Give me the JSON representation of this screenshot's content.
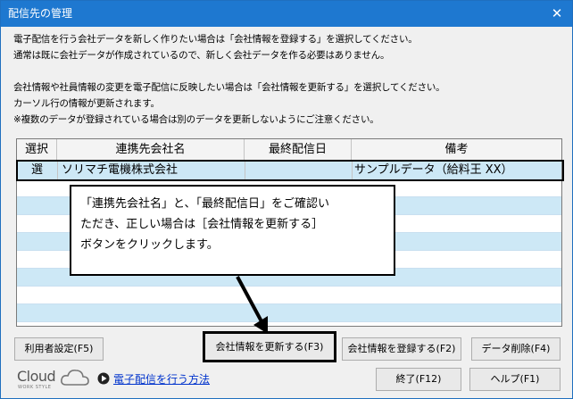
{
  "window": {
    "title": "配信先の管理",
    "close_glyph": "✕"
  },
  "messages": [
    "電子配信を行う会社データを新しく作りたい場合は「会社情報を登録する」を選択してください。",
    "通常は既に会社データが作成されているので、新しく会社データを作る必要はありません。",
    "会社情報や社員情報の変更を電子配信に反映したい場合は「会社情報を更新する」を選択してください。",
    "カーソル行の情報が更新されます。",
    "※複数のデータが登録されている場合は別のデータを更新しないようにご注意ください。"
  ],
  "grid": {
    "columns": [
      "選択",
      "連携先会社名",
      "最終配信日",
      "備考"
    ],
    "rows": [
      {
        "select": "選",
        "company": "ソリマチ電機株式会社",
        "last_date": "",
        "note": "サンプルデータ（給料王 XX）"
      }
    ]
  },
  "callout": {
    "lines": [
      "「連携先会社名」と、「最終配信日」をご確認い",
      "ただき、正しい場合は［会社情報を更新する］",
      "ボタンをクリックします。"
    ]
  },
  "buttons": {
    "user_settings": "利用者設定(F5)",
    "update_company": "会社情報を更新する(F3)",
    "register_company": "会社情報を登録する(F2)",
    "delete_data": "データ削除(F4)",
    "exit": "終了(F12)",
    "help": "ヘルプ(F1)"
  },
  "footer": {
    "logo_text": "Cloud",
    "logo_sub": "WORK STYLE",
    "help_link": "電子配信を行う方法"
  },
  "colors": {
    "titlebar": "#1e78d0",
    "row_alt": "#cde8f6",
    "link": "#0033cc"
  },
  "icons": [
    "close-icon",
    "cloud-icon",
    "play-icon"
  ]
}
